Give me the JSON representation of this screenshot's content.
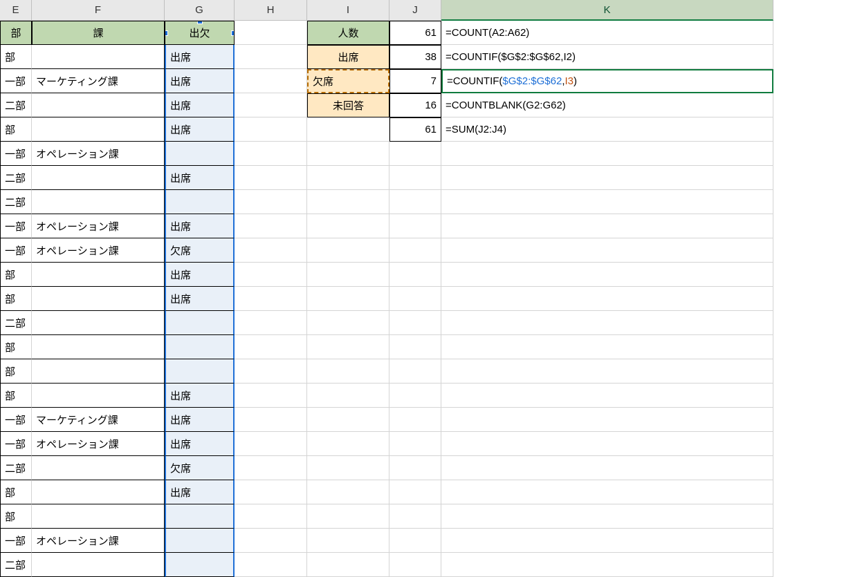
{
  "columns": {
    "E": "E",
    "F": "F",
    "G": "G",
    "H": "H",
    "I": "I",
    "J": "J",
    "K": "K"
  },
  "headers": {
    "E": "部",
    "F": "課",
    "G": "出欠",
    "I": "人数"
  },
  "rows": [
    {
      "E": "部",
      "F": "",
      "G": "出席"
    },
    {
      "E": "一部",
      "F": "マーケティング課",
      "G": "出席"
    },
    {
      "E": "二部",
      "F": "",
      "G": "出席"
    },
    {
      "E": "部",
      "F": "",
      "G": "出席"
    },
    {
      "E": "一部",
      "F": "オペレーション課",
      "G": ""
    },
    {
      "E": "二部",
      "F": "",
      "G": "出席"
    },
    {
      "E": "二部",
      "F": "",
      "G": ""
    },
    {
      "E": "一部",
      "F": "オペレーション課",
      "G": "出席"
    },
    {
      "E": "一部",
      "F": "オペレーション課",
      "G": "欠席"
    },
    {
      "E": "部",
      "F": "",
      "G": "出席"
    },
    {
      "E": "部",
      "F": "",
      "G": "出席"
    },
    {
      "E": "二部",
      "F": "",
      "G": ""
    },
    {
      "E": "部",
      "F": "",
      "G": ""
    },
    {
      "E": "部",
      "F": "",
      "G": ""
    },
    {
      "E": "部",
      "F": "",
      "G": "出席"
    },
    {
      "E": "一部",
      "F": "マーケティング課",
      "G": "出席"
    },
    {
      "E": "一部",
      "F": "オペレーション課",
      "G": "出席"
    },
    {
      "E": "二部",
      "F": "",
      "G": "欠席"
    },
    {
      "E": "部",
      "F": "",
      "G": "出席"
    },
    {
      "E": "部",
      "F": "",
      "G": ""
    },
    {
      "E": "一部",
      "F": "オペレーション課",
      "G": ""
    },
    {
      "E": "二部",
      "F": "",
      "G": ""
    }
  ],
  "stats": {
    "count": {
      "label": "人数",
      "J": "61",
      "K": "=COUNT(A2:A62)"
    },
    "attend": {
      "label": "出席",
      "J": "38",
      "K": "=COUNTIF($G$2:$G$62,I2)"
    },
    "absent": {
      "label": "欠席",
      "J": "7",
      "K_pre": "=COUNTIF(",
      "K_range": "$G$2:$G$62",
      "K_comma": ",",
      "K_crit": "I3",
      "K_post": ")"
    },
    "nores": {
      "label": "未回答",
      "J": "16",
      "K": "=COUNTBLANK(G2:G62)"
    },
    "sum": {
      "J": "61",
      "K": "=SUM(J2:J4)"
    }
  }
}
